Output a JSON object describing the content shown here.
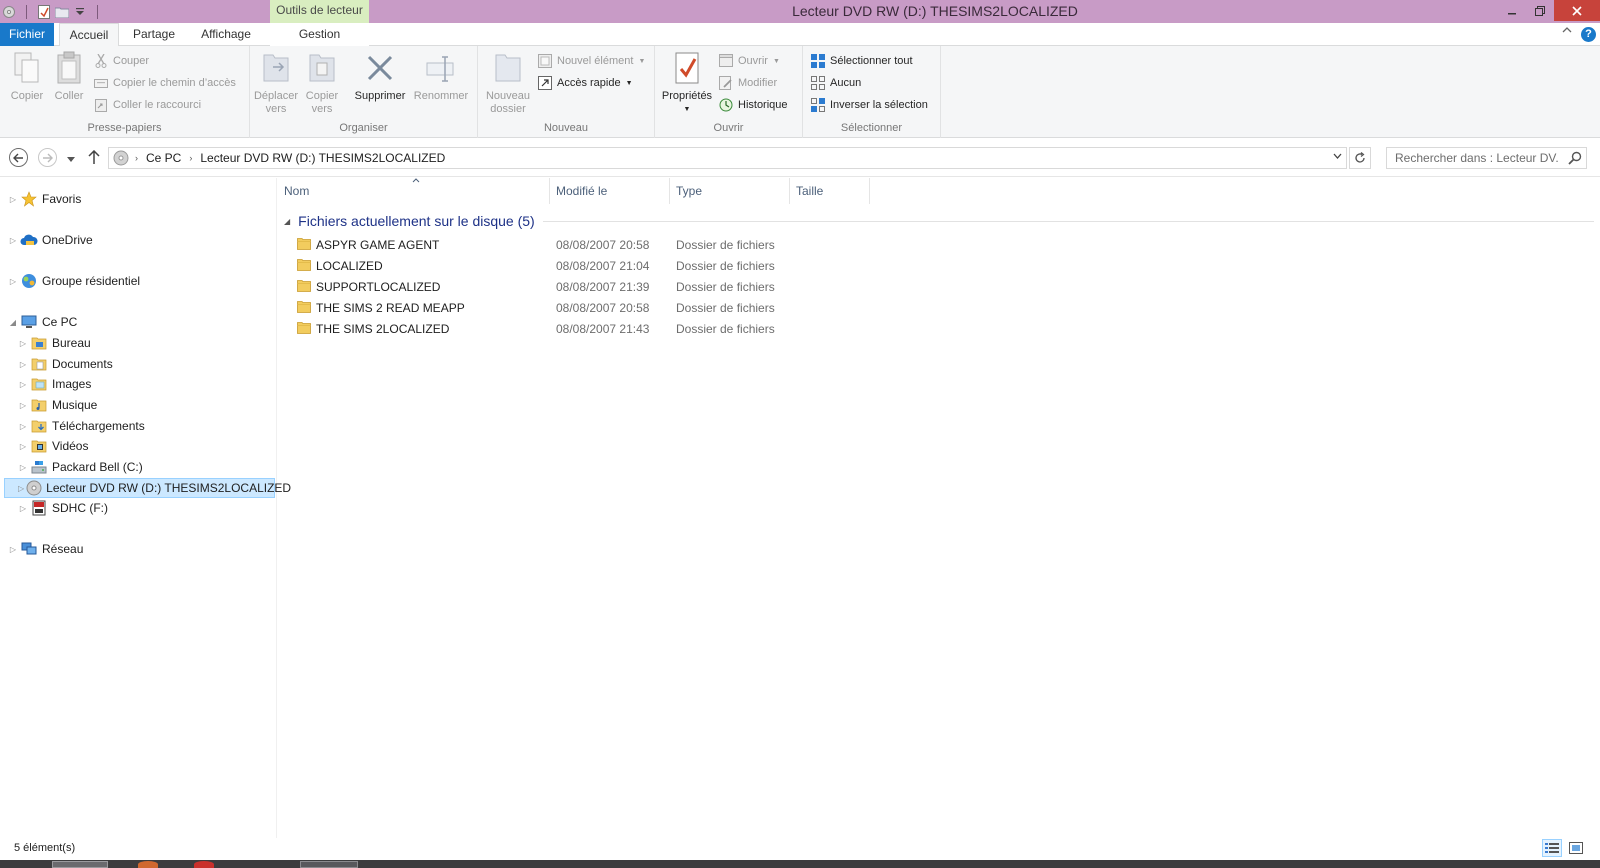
{
  "window": {
    "title": "Lecteur DVD RW (D:) THESIMS2LOCALIZED",
    "context_tab": "Outils de lecteur",
    "accent": "#1979ca",
    "titlebar_color": "#c89bc6",
    "context_color": "#d9eec0"
  },
  "tabs": {
    "file": "Fichier",
    "home": "Accueil",
    "share": "Partage",
    "view": "Affichage",
    "manage": "Gestion"
  },
  "ribbon": {
    "clipboard": {
      "label": "Presse-papiers",
      "copy": "Copier",
      "paste": "Coller",
      "cut": "Couper",
      "copy_path": "Copier le chemin d’accès",
      "paste_shortcut": "Coller le raccourci"
    },
    "organize": {
      "label": "Organiser",
      "move_to": "Déplacer vers",
      "copy_to": "Copier vers",
      "delete": "Supprimer",
      "rename": "Renommer"
    },
    "new": {
      "label": "Nouveau",
      "new_folder": "Nouveau dossier",
      "new_item": "Nouvel élément",
      "easy_access": "Accès rapide"
    },
    "open": {
      "label": "Ouvrir",
      "properties": "Propriétés",
      "open": "Ouvrir",
      "edit": "Modifier",
      "history": "Historique"
    },
    "select": {
      "label": "Sélectionner",
      "select_all": "Sélectionner tout",
      "select_none": "Aucun",
      "invert": "Inverser la sélection"
    }
  },
  "address": {
    "crumbs": [
      "Ce PC",
      "Lecteur DVD RW (D:) THESIMS2LOCALIZED"
    ],
    "search_placeholder": "Rechercher dans : Lecteur DV..."
  },
  "nav": {
    "favorites": "Favoris",
    "onedrive": "OneDrive",
    "homegroup": "Groupe résidentiel",
    "this_pc": "Ce PC",
    "desktop": "Bureau",
    "documents": "Documents",
    "pictures": "Images",
    "music": "Musique",
    "downloads": "Téléchargements",
    "videos": "Vidéos",
    "drive_c": "Packard Bell (C:)",
    "drive_d": "Lecteur DVD RW (D:) THESIMS2LOCALIZED",
    "drive_f": "SDHC (F:)",
    "network": "Réseau"
  },
  "columns": {
    "name": "Nom",
    "modified": "Modifié le",
    "type": "Type",
    "size": "Taille"
  },
  "group": {
    "title": "Fichiers actuellement sur le disque (5)"
  },
  "files": [
    {
      "name": "ASPYR GAME AGENT",
      "modified": "08/08/2007 20:58",
      "type": "Dossier de fichiers"
    },
    {
      "name": "LOCALIZED",
      "modified": "08/08/2007 21:04",
      "type": "Dossier de fichiers"
    },
    {
      "name": "SUPPORTLOCALIZED",
      "modified": "08/08/2007 21:39",
      "type": "Dossier de fichiers"
    },
    {
      "name": "THE SIMS 2 READ MEAPP",
      "modified": "08/08/2007 20:58",
      "type": "Dossier de fichiers"
    },
    {
      "name": "THE SIMS 2LOCALIZED",
      "modified": "08/08/2007 21:43",
      "type": "Dossier de fichiers"
    }
  ],
  "status": {
    "count": "5 élément(s)"
  }
}
